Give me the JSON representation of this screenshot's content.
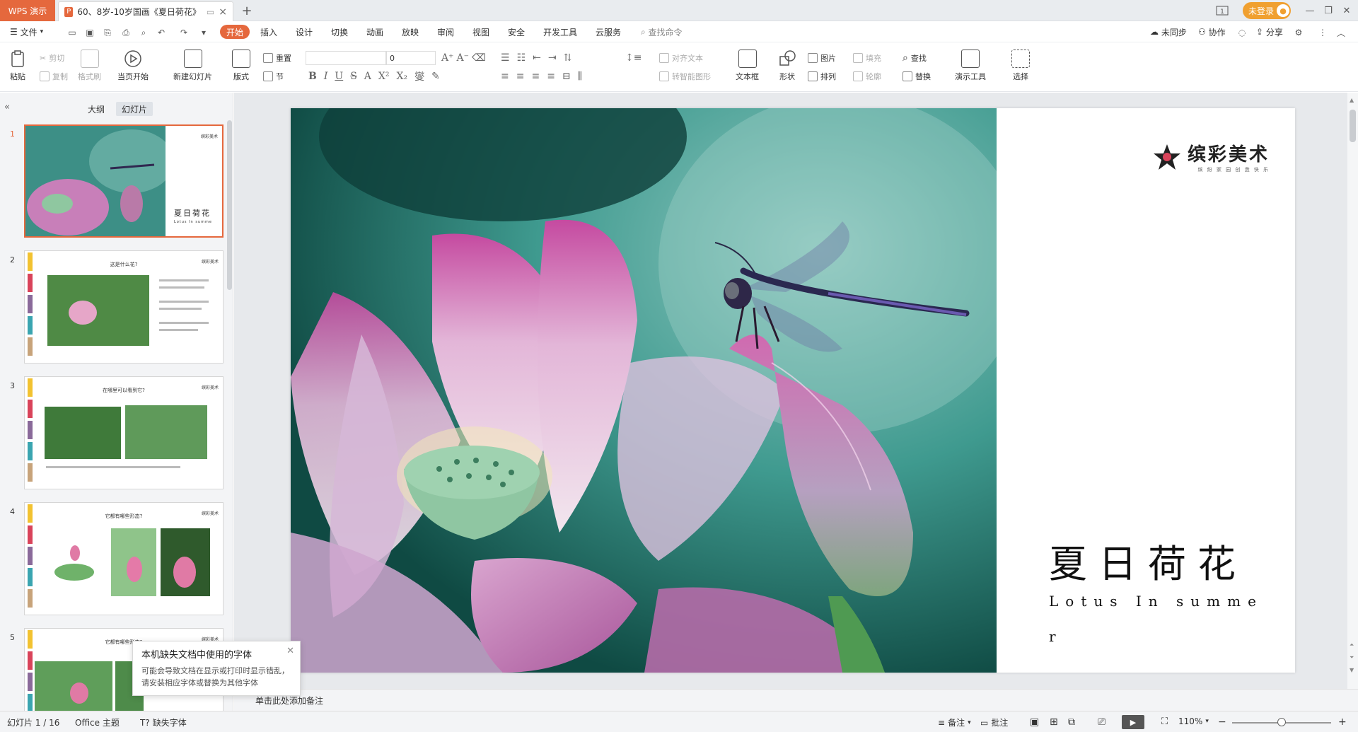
{
  "app": {
    "name": "WPS 演示"
  },
  "tab": {
    "title": "60、8岁-10岁国画《夏日荷花》",
    "file_icon": "P"
  },
  "titlebar": {
    "login_label": "未登录"
  },
  "menu": {
    "file": "文件",
    "items": [
      "开始",
      "插入",
      "设计",
      "切换",
      "动画",
      "放映",
      "审阅",
      "视图",
      "安全",
      "开发工具",
      "云服务"
    ],
    "active": "开始",
    "search_placeholder": "查找命令",
    "right": [
      "未同步",
      "协作",
      "分享"
    ]
  },
  "ribbon": {
    "paste": "粘贴",
    "cut": "剪切",
    "copy": "复制",
    "format_painter": "格式刷",
    "start_from_current": "当页开始",
    "new_slide": "新建幻灯片",
    "layout": "版式",
    "reset": "重置",
    "section": "节",
    "font_size": "0",
    "align_text": "对齐文本",
    "smart_shape": "转智能图形",
    "text_box": "文本框",
    "shape": "形状",
    "picture": "图片",
    "arrange": "排列",
    "fill": "填充",
    "outline": "轮廓",
    "find": "查找",
    "replace": "替换",
    "presenter_tools": "演示工具",
    "select": "选择"
  },
  "sidebar": {
    "tabs": [
      "大纲",
      "幻灯片"
    ],
    "active_tab": "幻灯片",
    "thumbs": [
      {
        "num": "1",
        "title": "夏日荷花",
        "subtitle": "Lotus In summe",
        "logo": "缤彩美术"
      },
      {
        "num": "2",
        "title": "这是什么花?",
        "logo": "缤彩美术"
      },
      {
        "num": "3",
        "title": "在哪里可以看到它?",
        "logo": "缤彩美术"
      },
      {
        "num": "4",
        "title": "它都有哪些形态?",
        "logo": "缤彩美术"
      },
      {
        "num": "5",
        "title": "它都有哪些形态?",
        "logo": "缤彩美术"
      }
    ]
  },
  "slide": {
    "logo_main": "缤彩美术",
    "logo_sub": "缤 纷 家 园   创 造 快 乐",
    "title": "夏日荷花",
    "subtitle_line1": "Lotus In summe",
    "subtitle_line2": "r"
  },
  "popup": {
    "title": "本机缺失文档中使用的字体",
    "body": "可能会导致文档在显示或打印时显示错乱，请安装相应字体或替换为其他字体"
  },
  "notes": {
    "placeholder": "单击此处添加备注"
  },
  "status": {
    "slide_count": "幻灯片 1 / 16",
    "theme": "Office 主题",
    "missing_font": "缺失字体",
    "notes": "备注",
    "comments": "批注",
    "zoom": "110%"
  },
  "colors": {
    "accent": "#e5683d",
    "strips": [
      "#f2c230",
      "#d9435a",
      "#8a6a9a",
      "#3aa5b0",
      "#c7a37a"
    ]
  }
}
